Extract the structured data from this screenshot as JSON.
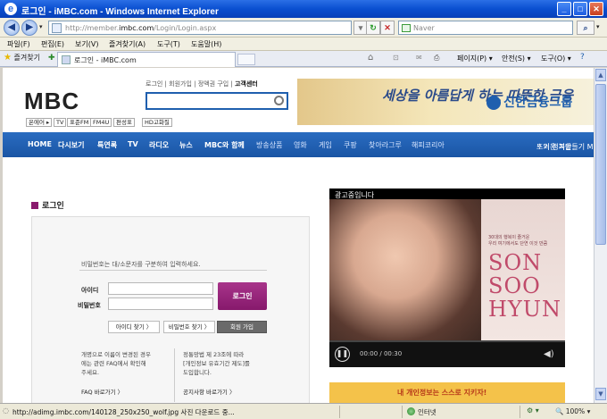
{
  "window": {
    "title": "로그인 - iMBC.com - Windows Internet Explorer"
  },
  "addressbar": {
    "url_prefix": "http://member.",
    "url_domain": "imbc.com",
    "url_suffix": "/Login/Login.aspx",
    "search_placeholder": "Naver"
  },
  "menubar": {
    "items": [
      "파일(F)",
      "편집(E)",
      "보기(V)",
      "즐겨찾기(A)",
      "도구(T)",
      "도움말(H)"
    ]
  },
  "tabbar": {
    "favorites": "즐겨찾기",
    "tab_title": "로그인 - iMBC.com",
    "commands": [
      "페이지(P) ▾",
      "안전(S) ▾",
      "도구(O) ▾"
    ]
  },
  "site": {
    "logo": "MBC",
    "toplinks": [
      "로그인",
      "회원가입",
      "정액권 구입"
    ],
    "toplink_strong": "고객센터",
    "channels": [
      "온에어 ▸",
      "TV",
      "표준FM",
      "FM4U",
      "편성표",
      "HD고화질"
    ],
    "banner_slogan": "세상을 아름답게 하는 따뜻한 금융",
    "banner_bank": "신한금융그룹",
    "nav_main": [
      "HOME",
      "다시보기",
      "특연록",
      "TV",
      "라디오",
      "뉴스",
      "MBC와 함께"
    ],
    "nav_sub": [
      "방송상품",
      "영화",
      "게임",
      "쿠팡",
      "찾아라그루",
      "해피코리아"
    ],
    "nav_right": [
      "뜨거운 겨울",
      "소외 행복만들기 MBC"
    ]
  },
  "login": {
    "title": "로그인",
    "hint": "비밀번호는 대/소문자를 구분하여 입력하세요.",
    "id_label": "아이디",
    "pw_label": "비밀번호",
    "login_button": "로그인",
    "find_id": "아이디 찾기 〉",
    "find_pw": "비밀번호 찾기 〉",
    "join": "회원 가입",
    "notice_left": [
      "개명으로 이름이 변경된 경우",
      "에는 관련 FAQ에서 확인해",
      "주세요."
    ],
    "notice_right": [
      "정통망법 제 23조에 따라",
      "[개인정보 유효기간 제도]를",
      "도입합니다."
    ],
    "faq_link": "FAQ 바로가기 〉",
    "notice_link": "공지사항 바로가기 〉"
  },
  "video": {
    "ad_label": "광고중입니다",
    "tagline": [
      "30대의 행복이 즐거운",
      "우리 여기에서도 단연 이것 만큼"
    ],
    "name_lines": [
      "SON",
      "SOO",
      "HYUN"
    ],
    "time": "00:00 / 00:30",
    "progress": 0
  },
  "privacy_banner": "내 개인정보는 스스로 지키자!",
  "statusbar": {
    "message": "http://adimg.imbc.com/140128_250x250_wolf.jpg 사진 다운로드 중...",
    "zone": "인터넷",
    "zoom": "100%"
  },
  "colors": {
    "ie_blue": "#0a4fd0",
    "mbc_nav": "#1a55a5",
    "login_purple": "#86196c",
    "banner_gold": "#e3c78a"
  }
}
